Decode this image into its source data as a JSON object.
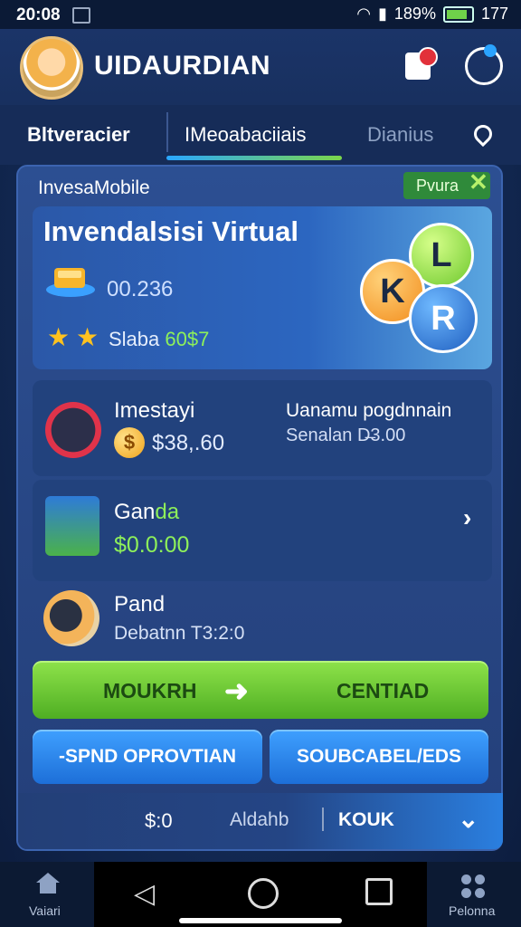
{
  "status_bar": {
    "time": "20:08",
    "battery_percent": "189%",
    "right_value": "177"
  },
  "header": {
    "title": "UIDAURDIAN",
    "notification_icon": "notification-icon",
    "profile_icon": "profile-icon"
  },
  "tabs": [
    {
      "label": "Bltveracier"
    },
    {
      "label": "IMeoabaciiais"
    },
    {
      "label": "Dianius"
    }
  ],
  "card": {
    "brand": "InvesaMobile",
    "badge": "Pvura",
    "hero": {
      "title": "Invendalsisi Virtual",
      "value": "00.236",
      "sub_prefix": "Slaba",
      "sub_value": "60$7"
    },
    "balls": [
      "L",
      "K",
      "R"
    ],
    "investment": {
      "title": "Imestayi",
      "value": "$38,.60",
      "right_title": "Uanamu pogdnnain",
      "right_value": "Senalan D̶3.00"
    },
    "ganda": {
      "title_prefix": "Gan",
      "title_suffix": "da",
      "value": "$0.0:00"
    },
    "paid": {
      "title": "Pand",
      "value": "Debatnn T3:2:0"
    },
    "green_button": {
      "left": "MOUKRH",
      "right": "CENTIAD"
    },
    "blue_buttons": {
      "left": "-SPND OPROVTIAN",
      "right": "SOUBCABEL/EDS"
    },
    "bottom_strip": {
      "v1": "$:0",
      "v2": "Aldahb",
      "v3": "KOUK"
    }
  },
  "nav": {
    "left_label": "Vaiari",
    "right_label": "Pelonna"
  }
}
